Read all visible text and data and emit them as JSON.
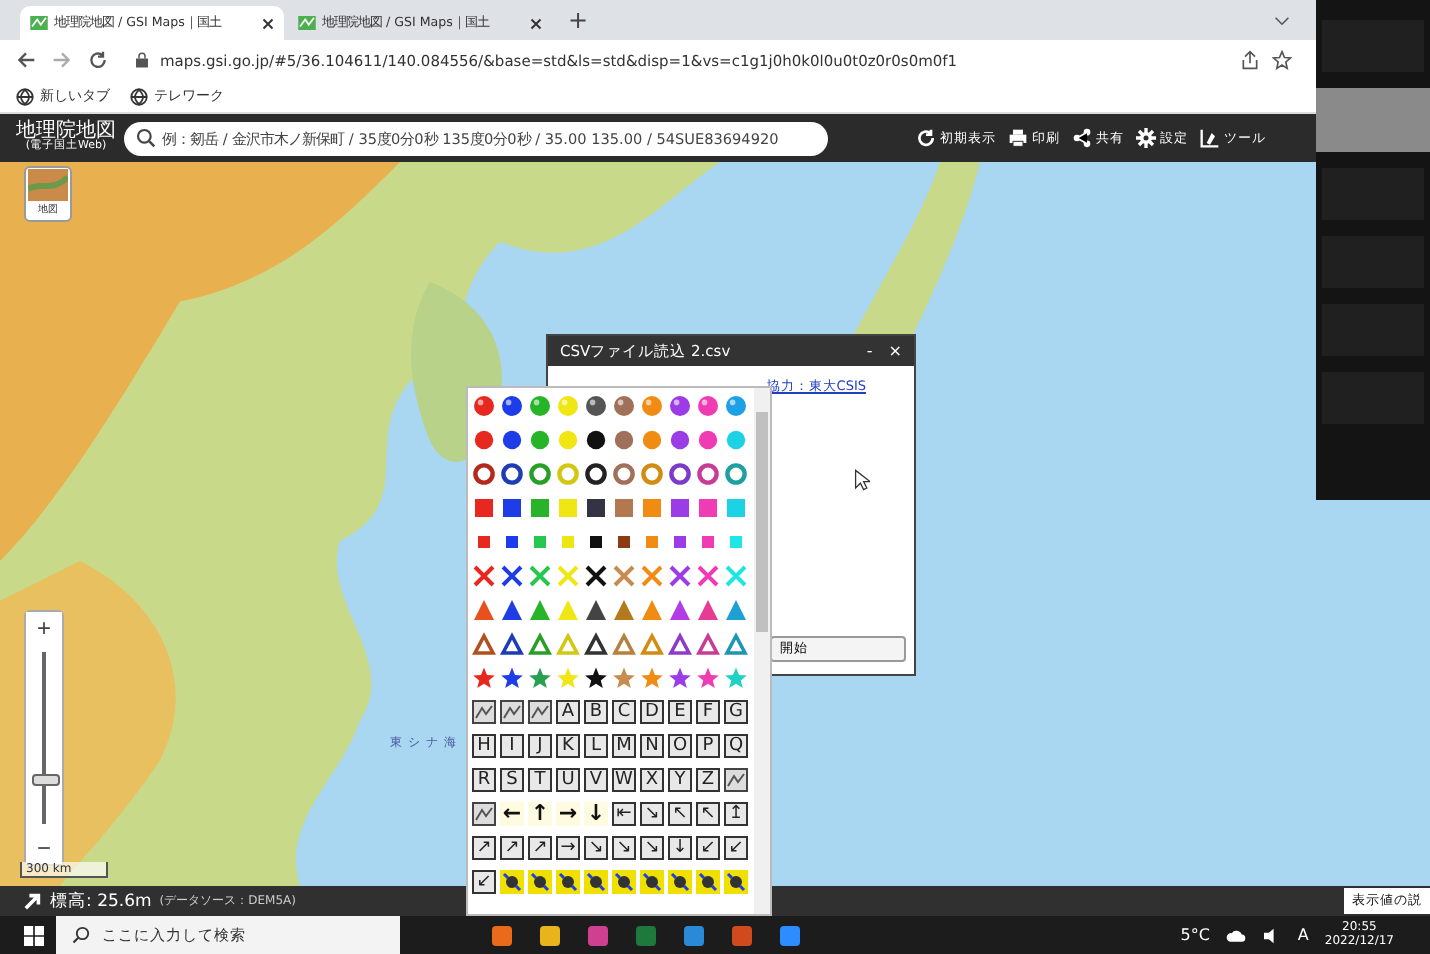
{
  "browser": {
    "tabs": [
      {
        "title": "地理院地図 / GSI Maps｜国土",
        "selected": true
      },
      {
        "title": "地理院地図 / GSI Maps｜国土",
        "selected": false
      }
    ],
    "new_tab": "+",
    "url": "maps.gsi.go.jp/#5/36.104611/140.084556/&base=std&ls=std&disp=1&vs=c1g1j0h0k0l0u0t0z0r0s0m0f1",
    "bookmarks": [
      "新しいタブ",
      "テレワーク"
    ]
  },
  "header": {
    "logo": "地理院地図",
    "logo_sub": "(電子国土Web)",
    "search": {
      "placeholder": "例：剱岳 / 金沢市木ノ新保町 / 35度0分0秒 135度0分0秒 / 35.00 135.00 / 54SUE83694920"
    },
    "tools": [
      {
        "label": "初期表示",
        "kind": "reset"
      },
      {
        "label": "印刷",
        "kind": "print"
      },
      {
        "label": "共有",
        "kind": "share"
      },
      {
        "label": "設定",
        "kind": "settings"
      },
      {
        "label": "ツール",
        "kind": "tools"
      }
    ]
  },
  "map": {
    "layer_button": "地図",
    "sea_label": "東シナ海",
    "zoom": {
      "in": "+",
      "out": "−",
      "level": 0.22
    },
    "scale": "300 km"
  },
  "dialog": {
    "title": "CSVファイル読込 2.csv",
    "minimize": "-",
    "close": "×",
    "credit": "協力：東大CSIS",
    "start": "開始"
  },
  "picker": {
    "rows": [
      {
        "kind": "sphere",
        "items": [
          {
            "color": "#e8281e"
          },
          {
            "color": "#1e3ce8"
          },
          {
            "color": "#28b428"
          },
          {
            "color": "#f0e614"
          },
          {
            "color": "#555555"
          },
          {
            "color": "#a0705a"
          },
          {
            "color": "#f08c14"
          },
          {
            "color": "#9b3ce6"
          },
          {
            "color": "#f03cb4"
          },
          {
            "color": "#1ea0e6"
          }
        ]
      },
      {
        "kind": "dot",
        "items": [
          {
            "color": "#e8281e"
          },
          {
            "color": "#1e3ce8"
          },
          {
            "color": "#28b428"
          },
          {
            "color": "#f0e614"
          },
          {
            "color": "#111111"
          },
          {
            "color": "#a0705a"
          },
          {
            "color": "#f08c14"
          },
          {
            "color": "#9b3ce6"
          },
          {
            "color": "#f03cb4"
          },
          {
            "color": "#1ed2e6"
          }
        ]
      },
      {
        "kind": "ring",
        "items": [
          {
            "color": "#b4281e"
          },
          {
            "color": "#1e3cb4"
          },
          {
            "color": "#28a028"
          },
          {
            "color": "#d2c814"
          },
          {
            "color": "#222222"
          },
          {
            "color": "#a0705a"
          },
          {
            "color": "#d28c14"
          },
          {
            "color": "#7a3cc8"
          },
          {
            "color": "#c83c96"
          },
          {
            "color": "#1ea0a0"
          }
        ]
      },
      {
        "kind": "square",
        "items": [
          {
            "color": "#e8281e"
          },
          {
            "color": "#1e3ce8"
          },
          {
            "color": "#28b428"
          },
          {
            "color": "#f0e614"
          },
          {
            "color": "#333344"
          },
          {
            "color": "#b47850"
          },
          {
            "color": "#f08c14"
          },
          {
            "color": "#9b3ce6"
          },
          {
            "color": "#f03cb4"
          },
          {
            "color": "#1ed2e6"
          }
        ]
      },
      {
        "kind": "small-square",
        "items": [
          {
            "color": "#e8281e"
          },
          {
            "color": "#1e3ce8"
          },
          {
            "color": "#28c850"
          },
          {
            "color": "#f0e614"
          },
          {
            "color": "#111111"
          },
          {
            "color": "#8c3c14"
          },
          {
            "color": "#f08c14"
          },
          {
            "color": "#9b3ce6"
          },
          {
            "color": "#f03cb4"
          },
          {
            "color": "#1ee6e6"
          }
        ]
      },
      {
        "kind": "cross",
        "items": [
          {
            "color": "#e8281e"
          },
          {
            "color": "#1e3ce8"
          },
          {
            "color": "#28c850"
          },
          {
            "color": "#f0e614"
          },
          {
            "color": "#111111"
          },
          {
            "color": "#c88c50"
          },
          {
            "color": "#f08c14"
          },
          {
            "color": "#9b3ce6"
          },
          {
            "color": "#f03cb4"
          },
          {
            "color": "#1ee6e6"
          }
        ]
      },
      {
        "kind": "triangle",
        "items": [
          {
            "color": "#e8501e"
          },
          {
            "color": "#1e3ce8"
          },
          {
            "color": "#28b428"
          },
          {
            "color": "#f0e614"
          },
          {
            "color": "#444444"
          },
          {
            "color": "#b4781e"
          },
          {
            "color": "#f08c14"
          },
          {
            "color": "#b43ce6"
          },
          {
            "color": "#e63c96"
          },
          {
            "color": "#1ea0d2"
          }
        ]
      },
      {
        "kind": "triangle-outline",
        "items": [
          {
            "color": "#b4501e"
          },
          {
            "color": "#1e3cb4"
          },
          {
            "color": "#28a028"
          },
          {
            "color": "#d2c814"
          },
          {
            "color": "#333333"
          },
          {
            "color": "#b4823c"
          },
          {
            "color": "#d28c14"
          },
          {
            "color": "#8c3cc8"
          },
          {
            "color": "#c83c96"
          },
          {
            "color": "#1e96b4"
          }
        ]
      },
      {
        "kind": "star",
        "items": [
          {
            "color": "#e8281e"
          },
          {
            "color": "#1e3ce8"
          },
          {
            "color": "#28a050"
          },
          {
            "color": "#f0e614"
          },
          {
            "color": "#111111"
          },
          {
            "color": "#c88c50"
          },
          {
            "color": "#f08c14"
          },
          {
            "color": "#9b3ce6"
          },
          {
            "color": "#f03cb4"
          },
          {
            "color": "#1ed2c8"
          }
        ]
      },
      {
        "kind": "tiles",
        "items": [
          {
            "kind": "pattern"
          },
          {
            "kind": "pattern"
          },
          {
            "kind": "pattern"
          },
          {
            "kind": "letter",
            "text": "A"
          },
          {
            "kind": "letter",
            "text": "B"
          },
          {
            "kind": "letter",
            "text": "C"
          },
          {
            "kind": "letter",
            "text": "D"
          },
          {
            "kind": "letter",
            "text": "E"
          },
          {
            "kind": "letter",
            "text": "F"
          },
          {
            "kind": "letter",
            "text": "G"
          }
        ]
      },
      {
        "kind": "tiles",
        "items": [
          {
            "kind": "letter",
            "text": "H"
          },
          {
            "kind": "letter",
            "text": "I"
          },
          {
            "kind": "letter",
            "text": "J"
          },
          {
            "kind": "letter",
            "text": "K"
          },
          {
            "kind": "letter",
            "text": "L"
          },
          {
            "kind": "letter",
            "text": "M"
          },
          {
            "kind": "letter",
            "text": "N"
          },
          {
            "kind": "letter",
            "text": "O"
          },
          {
            "kind": "letter",
            "text": "P"
          },
          {
            "kind": "letter",
            "text": "Q"
          }
        ]
      },
      {
        "kind": "tiles",
        "items": [
          {
            "kind": "letter",
            "text": "R"
          },
          {
            "kind": "letter",
            "text": "S"
          },
          {
            "kind": "letter",
            "text": "T"
          },
          {
            "kind": "letter",
            "text": "U"
          },
          {
            "kind": "letter",
            "text": "V"
          },
          {
            "kind": "letter",
            "text": "W"
          },
          {
            "kind": "letter",
            "text": "X"
          },
          {
            "kind": "letter",
            "text": "Y"
          },
          {
            "kind": "letter",
            "text": "Z"
          },
          {
            "kind": "pattern"
          }
        ]
      },
      {
        "kind": "tiles",
        "items": [
          {
            "kind": "pattern"
          },
          {
            "kind": "arrow",
            "text": "←"
          },
          {
            "kind": "arrow",
            "text": "↑"
          },
          {
            "kind": "arrow",
            "text": "→"
          },
          {
            "kind": "arrow",
            "text": "↓"
          },
          {
            "kind": "letter",
            "text": "⇤"
          },
          {
            "kind": "letter",
            "text": "↘"
          },
          {
            "kind": "letter",
            "text": "↖"
          },
          {
            "kind": "letter",
            "text": "↖"
          },
          {
            "kind": "letter",
            "text": "↥"
          }
        ]
      },
      {
        "kind": "tiles",
        "items": [
          {
            "kind": "letter",
            "text": "↗"
          },
          {
            "kind": "letter",
            "text": "↗"
          },
          {
            "kind": "letter",
            "text": "↗"
          },
          {
            "kind": "letter",
            "text": "→"
          },
          {
            "kind": "letter",
            "text": "↘"
          },
          {
            "kind": "letter",
            "text": "↘"
          },
          {
            "kind": "letter",
            "text": "↘"
          },
          {
            "kind": "letter",
            "text": "↓"
          },
          {
            "kind": "letter",
            "text": "↙"
          },
          {
            "kind": "letter",
            "text": "↙"
          }
        ]
      },
      {
        "kind": "tiles",
        "items": [
          {
            "kind": "letter",
            "text": "↙"
          },
          {
            "kind": "signal"
          },
          {
            "kind": "signal"
          },
          {
            "kind": "signal"
          },
          {
            "kind": "signal"
          },
          {
            "kind": "signal"
          },
          {
            "kind": "signal"
          },
          {
            "kind": "signal"
          },
          {
            "kind": "signal"
          },
          {
            "kind": "signal"
          }
        ]
      }
    ]
  },
  "status": {
    "elevation": "標高: 25.6m",
    "source": "(データソース：DEM5A)",
    "help": "表示値の説"
  },
  "taskbar": {
    "search": "ここに入力して検索",
    "weather": "5°C",
    "ime": "A",
    "time": "20:55",
    "date": "2022/12/17"
  },
  "participants": [
    {
      "kind": "name"
    },
    {
      "kind": "video"
    },
    {
      "kind": "name"
    },
    {
      "kind": "name"
    },
    {
      "kind": "name"
    },
    {
      "kind": "name"
    }
  ]
}
